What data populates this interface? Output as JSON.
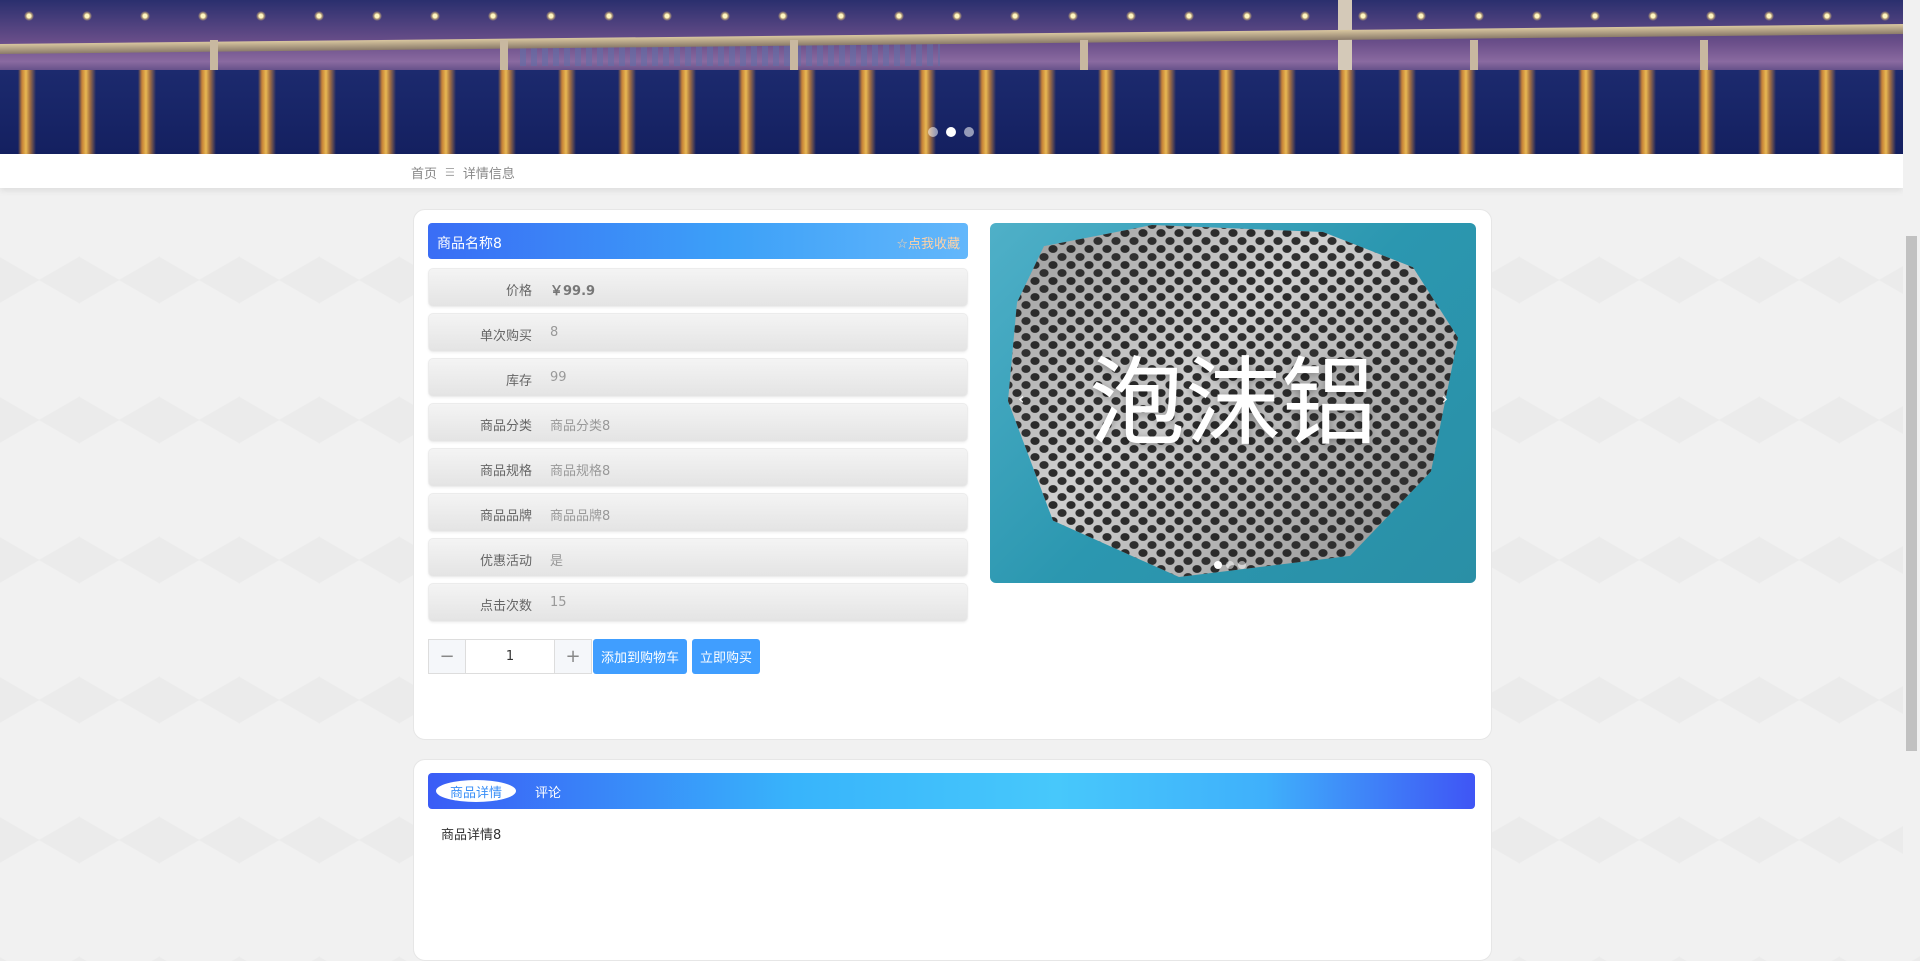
{
  "banner": {
    "dots": [
      false,
      true,
      false
    ]
  },
  "breadcrumb": {
    "home": "首页",
    "separator": "☰",
    "current": "详情信息"
  },
  "product": {
    "name": "商品名称8",
    "favorite_label": "☆点我收藏",
    "fields": [
      {
        "label": "价格",
        "value": "￥99.9"
      },
      {
        "label": "单次购买",
        "value": "8"
      },
      {
        "label": "库存",
        "value": "99"
      },
      {
        "label": "商品分类",
        "value": "商品分类8"
      },
      {
        "label": "商品规格",
        "value": "商品规格8"
      },
      {
        "label": "商品品牌",
        "value": "商品品牌8"
      },
      {
        "label": "优惠活动",
        "value": "是"
      },
      {
        "label": "点击次数",
        "value": "15"
      }
    ],
    "image_text": "泡沫铝",
    "image_dots": [
      true,
      false,
      false
    ],
    "quantity": "1",
    "minus_label": "−",
    "plus_label": "+",
    "add_to_cart_label": "添加到购物车",
    "buy_now_label": "立即购买"
  },
  "tabs": {
    "active": "商品详情",
    "other": "评论"
  },
  "detail": {
    "text": "商品详情8"
  },
  "colors": {
    "accent": "#409eff",
    "title_gradient_start": "#3a6df5",
    "favorite": "#ffd2a6"
  }
}
